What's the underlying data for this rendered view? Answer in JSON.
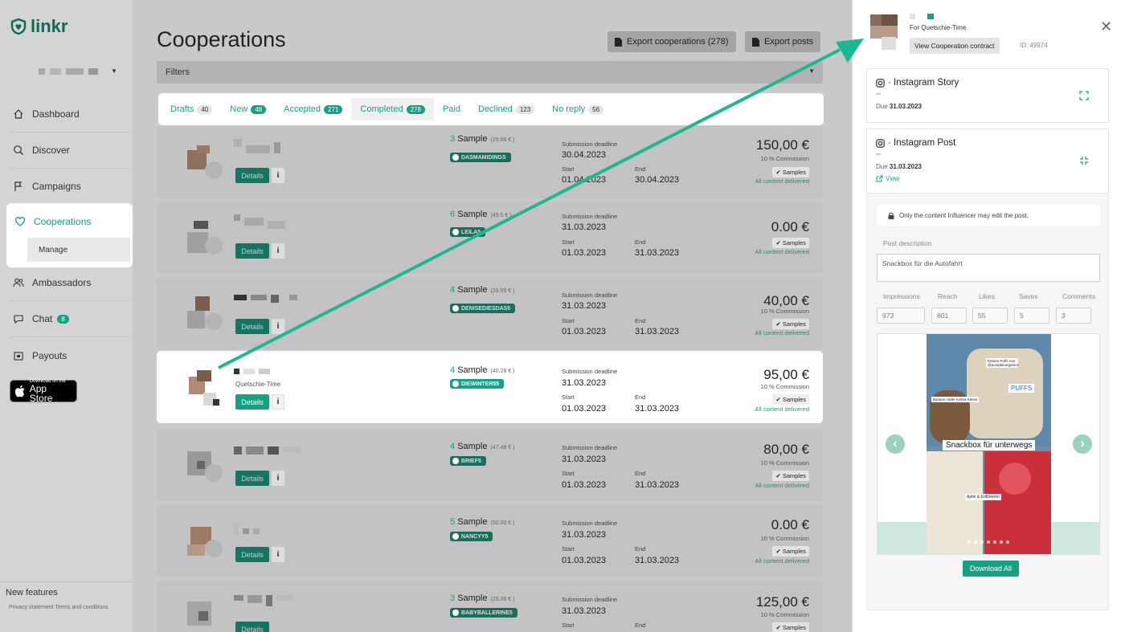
{
  "brand": {
    "name": "linkr",
    "accent": "#17a184"
  },
  "sidebar": {
    "items": [
      {
        "label": "Dashboard",
        "icon": "home-icon"
      },
      {
        "label": "Discover",
        "icon": "search-icon"
      },
      {
        "label": "Campaigns",
        "icon": "flag-icon"
      },
      {
        "label": "Cooperations",
        "icon": "heart-icon"
      },
      {
        "label": "Manage"
      },
      {
        "label": "Ambassadors",
        "icon": "users-icon"
      },
      {
        "label": "Chat",
        "icon": "chat-icon",
        "badge": "8"
      },
      {
        "label": "Payouts",
        "icon": "wallet-icon"
      }
    ],
    "appstore_line1": "Download on the",
    "appstore_line2": "App Store",
    "new_features": "New features",
    "legal": "Privacy statement Terms and conditions"
  },
  "header": {
    "title": "Cooperations",
    "export_coop": "Export cooperations (278)",
    "export_posts": "Export posts",
    "filters": "Filters"
  },
  "tabs": [
    {
      "label": "Drafts",
      "count": "40"
    },
    {
      "label": "New",
      "count": "48"
    },
    {
      "label": "Accepted",
      "count": "271"
    },
    {
      "label": "Completed",
      "count": "278"
    },
    {
      "label": "Paid",
      "count": ""
    },
    {
      "label": "Declined",
      "count": "123"
    },
    {
      "label": "No reply",
      "count": "56"
    }
  ],
  "rows": [
    {
      "samples": "3",
      "sample_word": "Sample",
      "price": "(29.96 € )",
      "code": "DASMAMIDINGS",
      "deadline": "30.04.2023",
      "start": "01.04.2023",
      "end": "30.04.2023",
      "amount": "150,00 €",
      "commission": "10 % Commission",
      "samples_tag": "Samples",
      "delivered": "All content delivered"
    },
    {
      "samples": "6",
      "sample_word": "Sample",
      "price": "(49.5 € )",
      "code": "LEILA5",
      "deadline": "31.03.2023",
      "start": "01.03.2023",
      "end": "31.03.2023",
      "amount": "0.00 €",
      "commission": "",
      "samples_tag": "Samples",
      "delivered": "All content delivered"
    },
    {
      "samples": "4",
      "sample_word": "Sample",
      "price": "(28.95 € )",
      "code": "DENISEDIESDAS5",
      "deadline": "31.03.2023",
      "start": "01.03.2023",
      "end": "31.03.2023",
      "amount": "40,00 €",
      "commission": "10 % Commission",
      "samples_tag": "Samples",
      "delivered": "All content delivered"
    },
    {
      "samples": "4",
      "sample_word": "Sample",
      "price": "(40.28 € )",
      "code": "DIEWINTER55",
      "deadline": "31.03.2023",
      "start": "01.03.2023",
      "end": "31.03.2023",
      "amount": "95,00 €",
      "commission": "10 % Commission",
      "samples_tag": "Samples",
      "delivered": "All content delivered",
      "subname": "Quetschie-Time"
    },
    {
      "samples": "4",
      "sample_word": "Sample",
      "price": "(47.48 € )",
      "code": "BRIEF5",
      "deadline": "31.03.2023",
      "start": "01.03.2023",
      "end": "31.03.2023",
      "amount": "80,00 €",
      "commission": "10 % Commission",
      "samples_tag": "Samples",
      "delivered": "All content delivered"
    },
    {
      "samples": "5",
      "sample_word": "Sample",
      "price": "(50.00 € )",
      "code": "NANCYY5",
      "deadline": "31.03.2023",
      "start": "01.03.2023",
      "end": "31.03.2023",
      "amount": "0.00 €",
      "commission": "10 % Commission",
      "samples_tag": "Samples",
      "delivered": "All content delivered"
    },
    {
      "samples": "3",
      "sample_word": "Sample",
      "price": "(29.36 € )",
      "code": "BABYBALLERINE5",
      "deadline": "31.03.2023",
      "start": "",
      "end": "",
      "amount": "125,00 €",
      "commission": "10 % Commission",
      "samples_tag": "Samples",
      "delivered": ""
    }
  ],
  "labels": {
    "details": "Details",
    "info": "i",
    "submission_deadline": "Submission deadline",
    "start": "Start",
    "end": "End"
  },
  "panel": {
    "for": "For Quetschie-Time",
    "contract": "View Cooperation contract",
    "id": "ID: 49974",
    "story_title": "· Instagram Story",
    "post_title": "· Instagram Post",
    "due_label": "Due",
    "due_date": "31.03.2023",
    "view": "View",
    "lock_note": "Only the content Influencer may edit the post.",
    "post_desc_label": "Post description",
    "post_desc": "Snackbox für die Autofahrt",
    "metrics": [
      {
        "label": "Impressions",
        "value": "973"
      },
      {
        "label": "Reach",
        "value": "801"
      },
      {
        "label": "Likes",
        "value": "55"
      },
      {
        "label": "Saves",
        "value": "5"
      },
      {
        "label": "Comments",
        "value": "3"
      }
    ],
    "photo_caption": "Snackbox für unterwegs",
    "photo_tag1": "Erbsen Puffs von @pumpkinorganics",
    "photo_tag2": "PUFFS",
    "photo_tag3": "Banane Hafer Kekse Kekse",
    "photo_tag4": "Apfel & Erdbeeren",
    "download_all": "Download All"
  }
}
